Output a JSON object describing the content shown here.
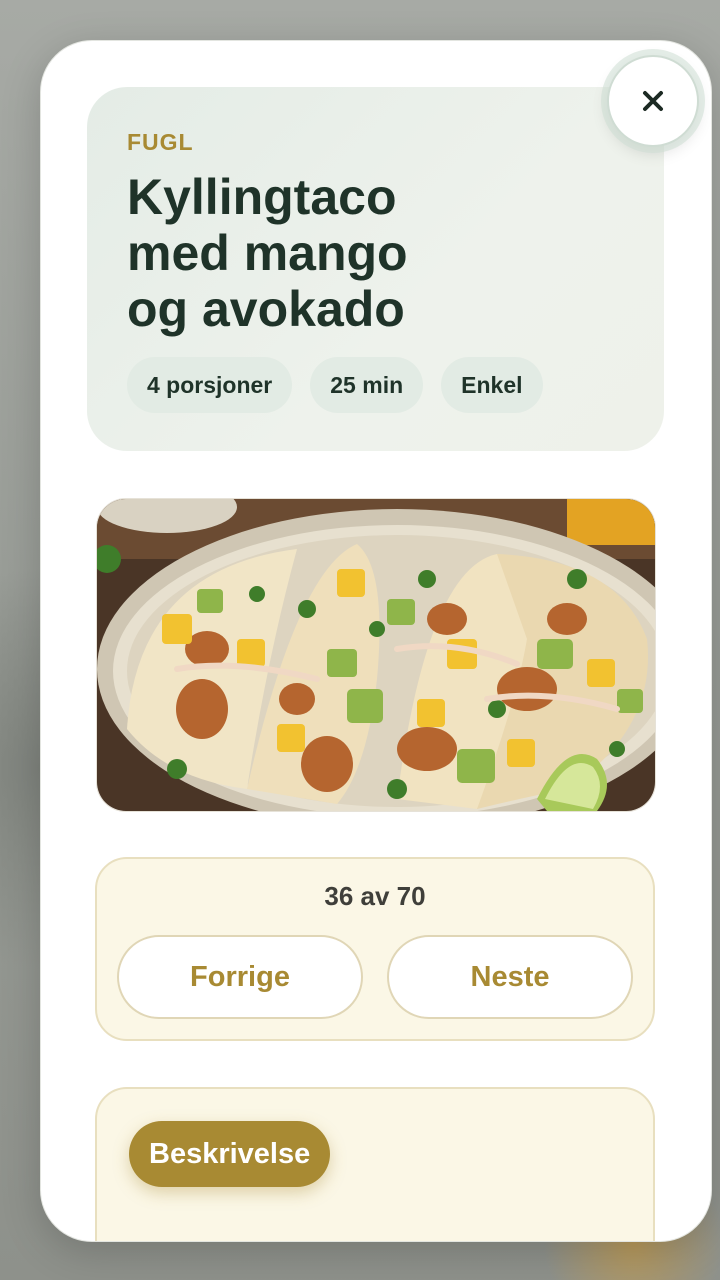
{
  "recipe": {
    "category": "FUGL",
    "title": "Kyllingtaco med mango og avokado",
    "meta": {
      "servings": "4 porsjoner",
      "time": "25 min",
      "difficulty": "Enkel"
    }
  },
  "navigation": {
    "counter": "36 av 70",
    "prev_label": "Forrige",
    "next_label": "Neste"
  },
  "description": {
    "tab_label": "Beskrivelse"
  },
  "icons": {
    "close": "close-icon"
  },
  "colors": {
    "accent_gold": "#a88a33",
    "title_green": "#1f3329",
    "header_bg": "#e4ece6",
    "card_cream": "#fbf7e6"
  }
}
